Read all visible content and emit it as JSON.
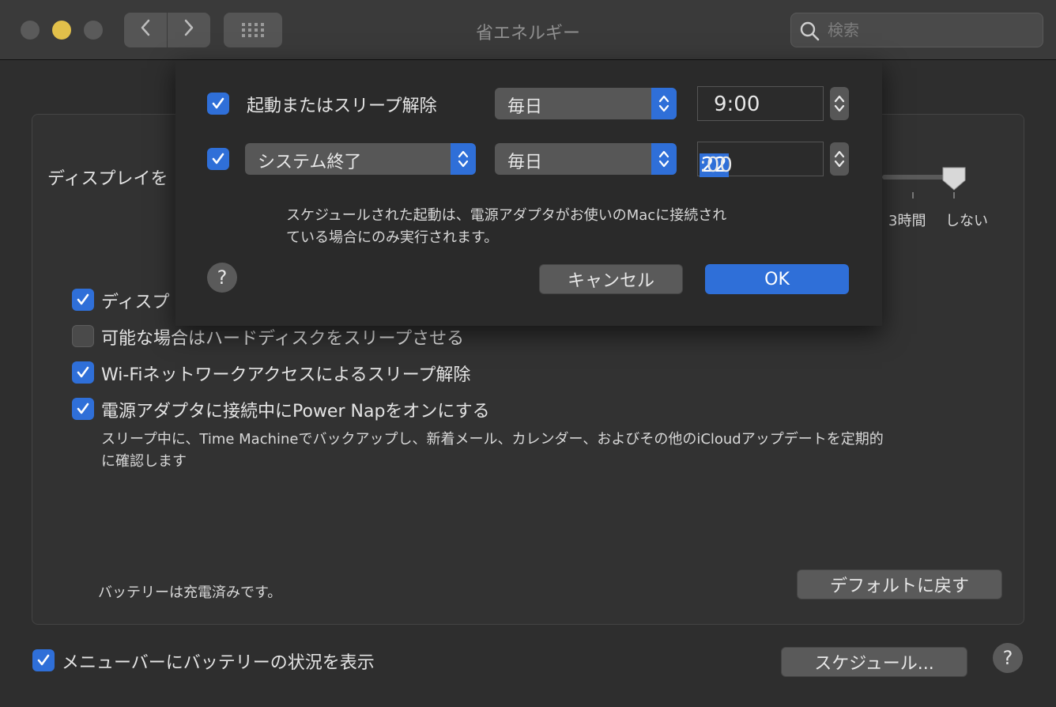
{
  "window": {
    "title": "省エネルギー"
  },
  "search": {
    "placeholder": "検索"
  },
  "main": {
    "display_sleep_label": "ディスプレイを",
    "slider": {
      "tick_3h": "3時間",
      "tick_never": "しない",
      "value": "しない"
    },
    "options": [
      {
        "label": "ディスプ",
        "checked": true
      },
      {
        "label": "可能な場合はハードディスクをスリープさせる",
        "checked": false
      },
      {
        "label": "Wi-Fiネットワークアクセスによるスリープ解除",
        "checked": true
      },
      {
        "label": "電源アダプタに接続中にPower Napをオンにする",
        "checked": true
      }
    ],
    "power_nap_desc_1": "スリープ中に、Time Machineでバックアップし、新着メール、カレンダー、およびその他のiCloudアップデートを定期的",
    "power_nap_desc_2": "に確認します",
    "battery_status": "バッテリーは充電済みです。",
    "restore_defaults": "デフォルトに戻す"
  },
  "footer": {
    "show_battery_label": "メニューバーにバッテリーの状況を表示",
    "show_battery_checked": true,
    "schedule_button": "スケジュール...",
    "help": "?"
  },
  "sheet": {
    "row1": {
      "checked": true,
      "label": "起動またはスリープ解除",
      "frequency": "毎日",
      "time": "9:00"
    },
    "row2": {
      "checked": true,
      "action": "システム終了",
      "frequency": "毎日",
      "time_hour": "22",
      "time_rest": ":00"
    },
    "note_1": "スケジュールされた起動は、電源アダプタがお使いのMacに接続され",
    "note_2": "ている場合にのみ実行されます。",
    "help": "?",
    "cancel": "キャンセル",
    "ok": "OK"
  },
  "colors": {
    "accent": "#2f6fd8",
    "window_bg": "#2e2e2e",
    "minimize": "#e2c04a"
  }
}
